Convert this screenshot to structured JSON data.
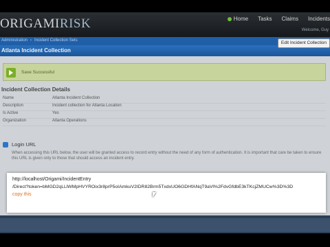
{
  "header": {
    "logo_main": "ORIGAMI",
    "logo_accent": "RISK",
    "nav": [
      {
        "label": "Home",
        "icon": "home-icon"
      },
      {
        "label": "Tasks"
      },
      {
        "label": "Claims"
      },
      {
        "label": "Incidents"
      }
    ],
    "welcome_text": "Welcome, Guy"
  },
  "breadcrumb": [
    "Administration",
    "Incident Collection Sets"
  ],
  "page": {
    "title": "Atlanta Incident Collection",
    "edit_button": "Edit Incident Collection"
  },
  "alert": {
    "text": "Save Successful"
  },
  "details": {
    "section_title": "Incident Collection Details",
    "rows": [
      {
        "key": "Name",
        "value": "Atlanta Incident Collection"
      },
      {
        "key": "Description",
        "value": "Incident collection for Atlanta Location"
      },
      {
        "key": "Is Active",
        "value": "Yes"
      },
      {
        "key": "Organization",
        "value": "Atlanta Operations"
      }
    ]
  },
  "login": {
    "title": "Login URL",
    "description": "When accessing this URL below, the user will be granted access to record entry without the need of any form of authentication. It is important that care be taken to ensure this URL is given only to those that should access an incident entry."
  },
  "popup": {
    "url_line1": "http://localhost/Origami/IncidentEntry",
    "url_line2": "/Direct?token=bMGD2qLLlWMpHVYROix3r8prP5oIAmkuV2IDR82Brm5TxdxUO6GDHfANqT9aVl%2FdvGfdbE3kTKcjZMUCw%3D%3D",
    "copy_label": "copy this"
  },
  "colors": {
    "topbar": "#1e2226",
    "blue_bar": "#1f5fa8",
    "alert_bg": "#c7d49c",
    "copy_link": "#e0711b"
  }
}
